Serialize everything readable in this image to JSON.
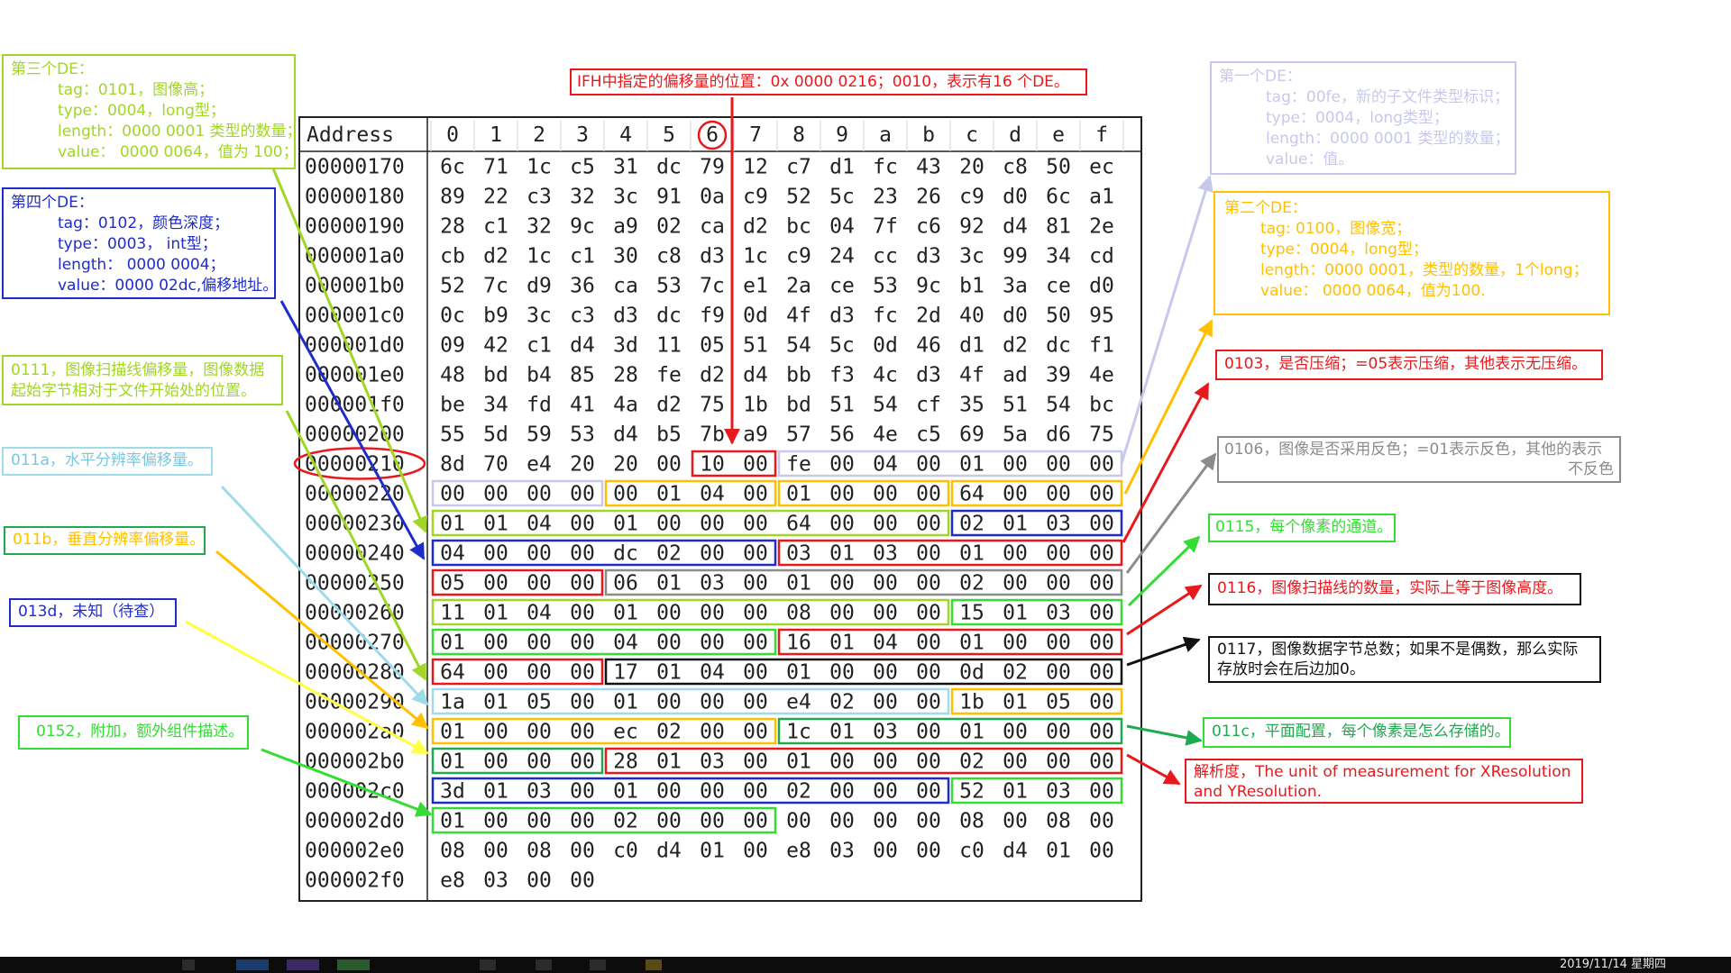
{
  "hex": {
    "header_label": "Address",
    "columns": [
      "0",
      "1",
      "2",
      "3",
      "4",
      "5",
      "6",
      "7",
      "8",
      "9",
      "a",
      "b",
      "c",
      "d",
      "e",
      "f"
    ],
    "highlighted_column": "6",
    "highlighted_address": "00000210",
    "rows": [
      {
        "address": "00000170",
        "bytes": [
          "6c",
          "71",
          "1c",
          "c5",
          "31",
          "dc",
          "79",
          "12",
          "c7",
          "d1",
          "fc",
          "43",
          "20",
          "c8",
          "50",
          "ec"
        ]
      },
      {
        "address": "00000180",
        "bytes": [
          "89",
          "22",
          "c3",
          "32",
          "3c",
          "91",
          "0a",
          "c9",
          "52",
          "5c",
          "23",
          "26",
          "c9",
          "d0",
          "6c",
          "a1"
        ]
      },
      {
        "address": "00000190",
        "bytes": [
          "28",
          "c1",
          "32",
          "9c",
          "a9",
          "02",
          "ca",
          "d2",
          "bc",
          "04",
          "7f",
          "c6",
          "92",
          "d4",
          "81",
          "2e"
        ]
      },
      {
        "address": "000001a0",
        "bytes": [
          "cb",
          "d2",
          "1c",
          "c1",
          "30",
          "c8",
          "d3",
          "1c",
          "c9",
          "24",
          "cc",
          "d3",
          "3c",
          "99",
          "34",
          "cd"
        ]
      },
      {
        "address": "000001b0",
        "bytes": [
          "52",
          "7c",
          "d9",
          "36",
          "ca",
          "53",
          "7c",
          "e1",
          "2a",
          "ce",
          "53",
          "9c",
          "b1",
          "3a",
          "ce",
          "d0"
        ]
      },
      {
        "address": "000001c0",
        "bytes": [
          "0c",
          "b9",
          "3c",
          "c3",
          "d3",
          "dc",
          "f9",
          "0d",
          "4f",
          "d3",
          "fc",
          "2d",
          "40",
          "d0",
          "50",
          "95"
        ]
      },
      {
        "address": "000001d0",
        "bytes": [
          "09",
          "42",
          "c1",
          "d4",
          "3d",
          "11",
          "05",
          "51",
          "54",
          "5c",
          "0d",
          "46",
          "d1",
          "d2",
          "dc",
          "f1"
        ]
      },
      {
        "address": "000001e0",
        "bytes": [
          "48",
          "bd",
          "b4",
          "85",
          "28",
          "fe",
          "d2",
          "d4",
          "bb",
          "f3",
          "4c",
          "d3",
          "4f",
          "ad",
          "39",
          "4e"
        ]
      },
      {
        "address": "000001f0",
        "bytes": [
          "be",
          "34",
          "fd",
          "41",
          "4a",
          "d2",
          "75",
          "1b",
          "bd",
          "51",
          "54",
          "cf",
          "35",
          "51",
          "54",
          "bc"
        ]
      },
      {
        "address": "00000200",
        "bytes": [
          "55",
          "5d",
          "59",
          "53",
          "d4",
          "b5",
          "7b",
          "a9",
          "57",
          "56",
          "4e",
          "c5",
          "69",
          "5a",
          "d6",
          "75"
        ]
      },
      {
        "address": "00000210",
        "bytes": [
          "8d",
          "70",
          "e4",
          "20",
          "20",
          "00",
          "10",
          "00",
          "fe",
          "00",
          "04",
          "00",
          "01",
          "00",
          "00",
          "00"
        ]
      },
      {
        "address": "00000220",
        "bytes": [
          "00",
          "00",
          "00",
          "00",
          "00",
          "01",
          "04",
          "00",
          "01",
          "00",
          "00",
          "00",
          "64",
          "00",
          "00",
          "00"
        ]
      },
      {
        "address": "00000230",
        "bytes": [
          "01",
          "01",
          "04",
          "00",
          "01",
          "00",
          "00",
          "00",
          "64",
          "00",
          "00",
          "00",
          "02",
          "01",
          "03",
          "00"
        ]
      },
      {
        "address": "00000240",
        "bytes": [
          "04",
          "00",
          "00",
          "00",
          "dc",
          "02",
          "00",
          "00",
          "03",
          "01",
          "03",
          "00",
          "01",
          "00",
          "00",
          "00"
        ]
      },
      {
        "address": "00000250",
        "bytes": [
          "05",
          "00",
          "00",
          "00",
          "06",
          "01",
          "03",
          "00",
          "01",
          "00",
          "00",
          "00",
          "02",
          "00",
          "00",
          "00"
        ]
      },
      {
        "address": "00000260",
        "bytes": [
          "11",
          "01",
          "04",
          "00",
          "01",
          "00",
          "00",
          "00",
          "08",
          "00",
          "00",
          "00",
          "15",
          "01",
          "03",
          "00"
        ]
      },
      {
        "address": "00000270",
        "bytes": [
          "01",
          "00",
          "00",
          "00",
          "04",
          "00",
          "00",
          "00",
          "16",
          "01",
          "04",
          "00",
          "01",
          "00",
          "00",
          "00"
        ]
      },
      {
        "address": "00000280",
        "bytes": [
          "64",
          "00",
          "00",
          "00",
          "17",
          "01",
          "04",
          "00",
          "01",
          "00",
          "00",
          "00",
          "0d",
          "02",
          "00",
          "00"
        ]
      },
      {
        "address": "00000290",
        "bytes": [
          "1a",
          "01",
          "05",
          "00",
          "01",
          "00",
          "00",
          "00",
          "e4",
          "02",
          "00",
          "00",
          "1b",
          "01",
          "05",
          "00"
        ]
      },
      {
        "address": "000002a0",
        "bytes": [
          "01",
          "00",
          "00",
          "00",
          "ec",
          "02",
          "00",
          "00",
          "1c",
          "01",
          "03",
          "00",
          "01",
          "00",
          "00",
          "00"
        ]
      },
      {
        "address": "000002b0",
        "bytes": [
          "01",
          "00",
          "00",
          "00",
          "28",
          "01",
          "03",
          "00",
          "01",
          "00",
          "00",
          "00",
          "02",
          "00",
          "00",
          "00"
        ]
      },
      {
        "address": "000002c0",
        "bytes": [
          "3d",
          "01",
          "03",
          "00",
          "01",
          "00",
          "00",
          "00",
          "02",
          "00",
          "00",
          "00",
          "52",
          "01",
          "03",
          "00"
        ]
      },
      {
        "address": "000002d0",
        "bytes": [
          "01",
          "00",
          "00",
          "00",
          "02",
          "00",
          "00",
          "00",
          "00",
          "00",
          "00",
          "00",
          "08",
          "00",
          "08",
          "00"
        ]
      },
      {
        "address": "000002e0",
        "bytes": [
          "08",
          "00",
          "08",
          "00",
          "c0",
          "d4",
          "01",
          "00",
          "e8",
          "03",
          "00",
          "00",
          "c0",
          "d4",
          "01",
          "00"
        ]
      },
      {
        "address": "000002f0",
        "bytes": [
          "e8",
          "03",
          "00",
          "00"
        ]
      }
    ]
  },
  "highlights": [
    {
      "row": 10,
      "start": 6,
      "len": 2,
      "color": "#e8191d"
    },
    {
      "row": 10,
      "start": 8,
      "len": 8,
      "color": "#c8c8ec"
    },
    {
      "row": 11,
      "start": 0,
      "len": 4,
      "color": "#c8c8ec"
    },
    {
      "row": 11,
      "start": 4,
      "len": 4,
      "color": "#ffc000"
    },
    {
      "row": 11,
      "start": 8,
      "len": 4,
      "color": "#ffc000"
    },
    {
      "row": 11,
      "start": 12,
      "len": 4,
      "color": "#ffc000"
    },
    {
      "row": 12,
      "start": 0,
      "len": 12,
      "color": "#a2d626"
    },
    {
      "row": 12,
      "start": 12,
      "len": 4,
      "color": "#1f2ccc"
    },
    {
      "row": 13,
      "start": 0,
      "len": 8,
      "color": "#1f2ccc"
    },
    {
      "row": 13,
      "start": 8,
      "len": 8,
      "color": "#e8191d"
    },
    {
      "row": 14,
      "start": 0,
      "len": 4,
      "color": "#e8191d"
    },
    {
      "row": 14,
      "start": 4,
      "len": 12,
      "color": "#8c8c8c"
    },
    {
      "row": 15,
      "start": 0,
      "len": 12,
      "color": "#a2d626"
    },
    {
      "row": 15,
      "start": 12,
      "len": 4,
      "color": "#33dd33"
    },
    {
      "row": 16,
      "start": 0,
      "len": 8,
      "color": "#33dd33"
    },
    {
      "row": 16,
      "start": 8,
      "len": 8,
      "color": "#e8191d"
    },
    {
      "row": 17,
      "start": 0,
      "len": 4,
      "color": "#e8191d"
    },
    {
      "row": 17,
      "start": 4,
      "len": 12,
      "color": "#111111"
    },
    {
      "row": 18,
      "start": 0,
      "len": 12,
      "color": "#9fdcea"
    },
    {
      "row": 18,
      "start": 12,
      "len": 4,
      "color": "#ffc000"
    },
    {
      "row": 19,
      "start": 0,
      "len": 8,
      "color": "#ffc000"
    },
    {
      "row": 19,
      "start": 8,
      "len": 8,
      "color": "#1eaa4e"
    },
    {
      "row": 20,
      "start": 0,
      "len": 4,
      "color": "#1eaa4e"
    },
    {
      "row": 20,
      "start": 4,
      "len": 12,
      "color": "#e8191d"
    },
    {
      "row": 21,
      "start": 0,
      "len": 12,
      "color": "#1f2ccc"
    },
    {
      "row": 21,
      "start": 12,
      "len": 4,
      "color": "#33dd33"
    },
    {
      "row": 22,
      "start": 0,
      "len": 8,
      "color": "#33dd33"
    }
  ],
  "annotations": {
    "ifh_offset": {
      "text": "IFH中指定的偏移量的位置：0x 0000 0216；0010，表示有16 个DE。",
      "color": "#e8191d"
    },
    "de3": {
      "color": "#a2d626",
      "lines": [
        "第三个DE：",
        "tag：0101，图像高；",
        "type：0004，long型；",
        "length：0000 0001 类型的数量；",
        "value： 0000 0064，值为 100；"
      ]
    },
    "de4": {
      "color": "#1f2ccc",
      "lines": [
        "第四个DE：",
        "tag：0102，颜色深度；",
        "type：0003， int型；",
        "length： 0000 0004；",
        "value：0000 02dc,偏移地址。"
      ]
    },
    "t0111": {
      "color": "#a2d626",
      "lines": [
        "0111，图像扫描线偏移量，图像数据",
        "起始字节相对于文件开始处的位置。"
      ]
    },
    "t011a": {
      "color": "#9fdcea",
      "text": "011a，水平分辨率偏移量。"
    },
    "t011b": {
      "color": "#1eaa4e",
      "text": "011b，垂直分辨率偏移量。"
    },
    "t013d": {
      "color": "#1f2ccc",
      "text": "013d，未知（待查）"
    },
    "t0152": {
      "color": "#33dd33",
      "text": "0152，附加，额外组件描述。"
    },
    "de1": {
      "color": "#c8c8ec",
      "lines": [
        "第一个DE：",
        "tag：00fe，新的子文件类型标识；",
        "type：0004，long类型；",
        "length：0000 0001 类型的数量；",
        "value：值。"
      ]
    },
    "de2": {
      "color": "#ffc000",
      "lines": [
        "第二个DE：",
        "tag: 0100，图像宽；",
        "type：0004，long型；",
        "length：0000 0001，类型的数量，1个long；",
        "value： 0000 0064，值为100."
      ]
    },
    "t0103": {
      "color": "#e8191d",
      "text": "0103，是否压缩；=05表示压缩，其他表示无压缩。"
    },
    "t0106": {
      "color": "#8c8c8c",
      "lines": [
        "0106，图像是否采用反色；=01表示反色，其他的表示",
        "不反色"
      ]
    },
    "t0115": {
      "color": "#33dd33",
      "text": "0115，每个像素的通道。"
    },
    "t0116": {
      "color": "#e8191d",
      "text": "0116，图像扫描线的数量，实际上等于图像高度。"
    },
    "t0117": {
      "color": "#111111",
      "lines": [
        "0117，图像数据字节总数；如果不是偶数，那么实际",
        "存放时会在后边加0。"
      ]
    },
    "t011c": {
      "color": "#1eaa4e",
      "text": "011c，平面配置，每个像素是怎么存储的。"
    },
    "t0128": {
      "color": "#e8191d",
      "lines": [
        "解析度，The unit of measurement for XResolution",
        "and YResolution."
      ]
    }
  },
  "taskbar": {
    "clock": "2019/11/14 星期四"
  }
}
